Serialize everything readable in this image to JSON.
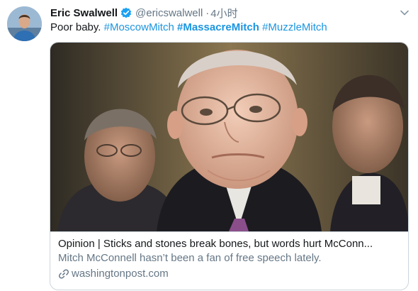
{
  "author": {
    "name": "Eric Swalwell",
    "handle": "@ericswalwell",
    "separator": "·",
    "time": "4小时",
    "verified_icon": "verified-badge-icon",
    "avatar": "avatar-photo"
  },
  "tweet": {
    "text_plain": "Poor baby.",
    "hashtags": [
      "#MoscowMitch",
      "#MassacreMitch",
      "#MuzzleMitch"
    ]
  },
  "menu": {
    "icon": "chevron-down-icon"
  },
  "card": {
    "title": "Opinion | Sticks and stones break bones, but words hurt McConn...",
    "description": "Mitch McConnell hasn’t been a fan of free speech lately.",
    "domain": "washingtonpost.com",
    "domain_icon": "link-icon",
    "image": "news-photo"
  },
  "colors": {
    "link": "#1b95e0",
    "text": "#14171a",
    "secondary": "#657786",
    "border": "#ccd6dd"
  }
}
